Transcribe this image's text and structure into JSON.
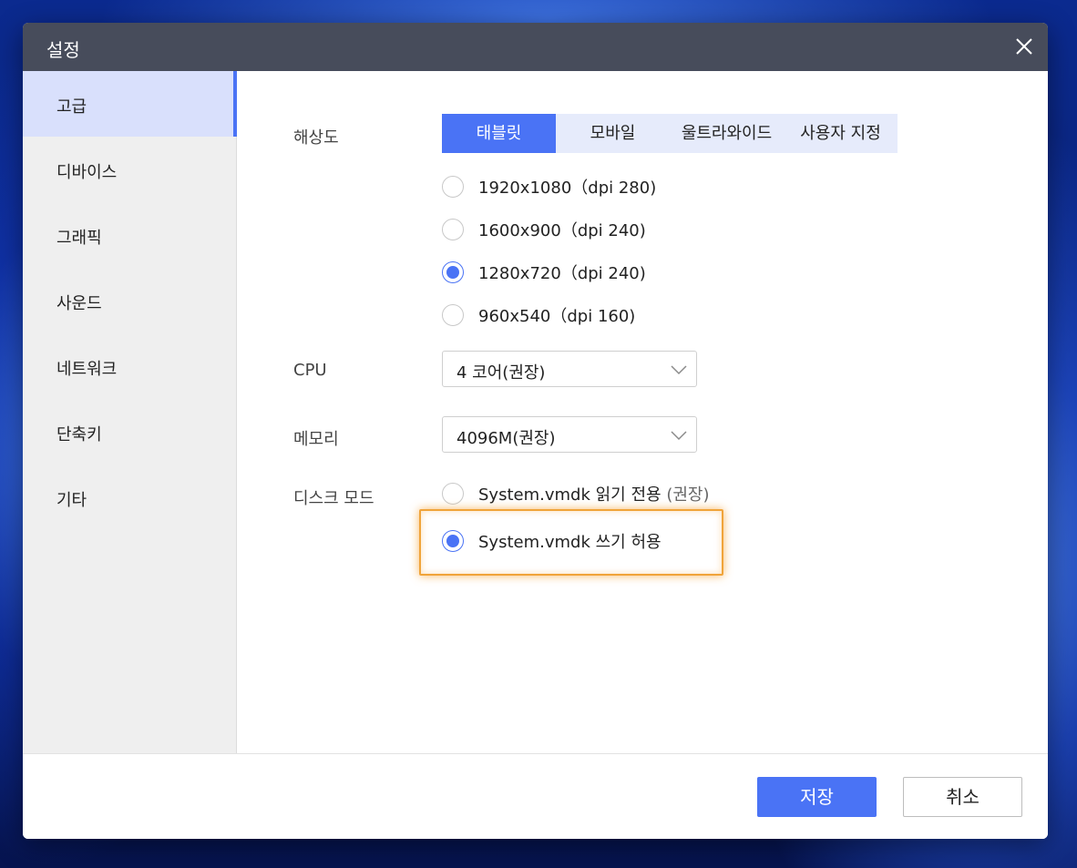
{
  "window": {
    "title": "설정"
  },
  "sidebar": {
    "items": [
      {
        "label": "고급",
        "active": true
      },
      {
        "label": "디바이스",
        "active": false
      },
      {
        "label": "그래픽",
        "active": false
      },
      {
        "label": "사운드",
        "active": false
      },
      {
        "label": "네트워크",
        "active": false
      },
      {
        "label": "단축키",
        "active": false
      },
      {
        "label": "기타",
        "active": false
      }
    ]
  },
  "resolution": {
    "label": "해상도",
    "tabs": [
      {
        "label": "태블릿",
        "active": true
      },
      {
        "label": "모바일",
        "active": false
      },
      {
        "label": "울트라와이드",
        "active": false
      },
      {
        "label": "사용자 지정",
        "active": false
      }
    ],
    "options": [
      {
        "label": "1920x1080（dpi 280)",
        "checked": false
      },
      {
        "label": "1600x900（dpi 240)",
        "checked": false
      },
      {
        "label": "1280x720（dpi 240)",
        "checked": true
      },
      {
        "label": "960x540（dpi 160)",
        "checked": false
      }
    ]
  },
  "cpu": {
    "label": "CPU",
    "value": "4 코어(권장)"
  },
  "memory": {
    "label": "메모리",
    "value": "4096M(권장)"
  },
  "disk_mode": {
    "label": "디스크 모드",
    "options": [
      {
        "label": "System.vmdk 읽기 전용",
        "hint": "(권장)",
        "checked": false
      },
      {
        "label": "System.vmdk 쓰기 허용",
        "hint": "",
        "checked": true
      }
    ]
  },
  "footer": {
    "save_label": "저장",
    "cancel_label": "취소"
  },
  "colors": {
    "accent": "#4a73f5",
    "titlebar": "#474c5b",
    "highlight": "#f0a43a"
  },
  "icons": {
    "close": "close-icon",
    "dropdown": "chevron-down-icon"
  }
}
